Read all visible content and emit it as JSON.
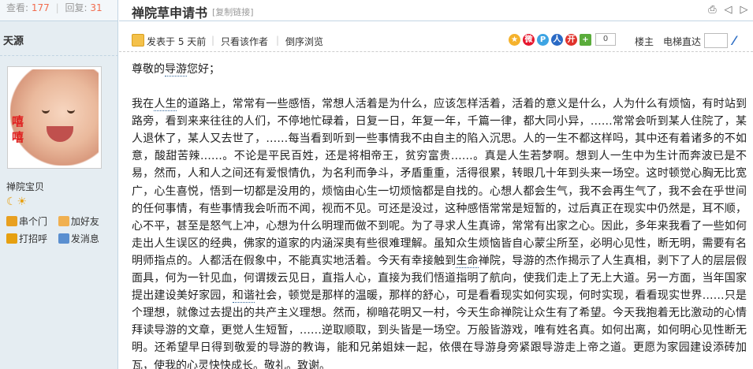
{
  "stats": {
    "views_label": "查看:",
    "views": "177",
    "replies_label": "回复:",
    "replies": "31"
  },
  "thread": {
    "title": "禅院草申请书",
    "copy_link": "[复制链接]"
  },
  "toolbar_icons": [
    "print-icon",
    "prev-thread-icon",
    "next-thread-icon"
  ],
  "author": {
    "name": "天源",
    "avatar_text": "嘻嘻",
    "group": "禅院宝贝",
    "stars": "☾☀"
  },
  "user_actions": [
    {
      "label": "串个门",
      "icon": "home-icon"
    },
    {
      "label": "加好友",
      "icon": "add-friend-icon"
    },
    {
      "label": "打招呼",
      "icon": "greet-icon"
    },
    {
      "label": "发消息",
      "icon": "message-icon"
    }
  ],
  "post_meta": {
    "posted": "发表于 5 天前",
    "only_author": "只看该作者",
    "reverse": "倒序浏览",
    "share_count": "0",
    "floor": "楼主",
    "jump_label": "电梯直达"
  },
  "share_icons": [
    {
      "name": "qzone-icon",
      "color": "#f5b22c",
      "glyph": "★"
    },
    {
      "name": "weibo-icon",
      "color": "#e6162d",
      "glyph": "微"
    },
    {
      "name": "tencent-weibo-icon",
      "color": "#3da4e3",
      "glyph": "P"
    },
    {
      "name": "renren-icon",
      "color": "#2a6ac5",
      "glyph": "人"
    },
    {
      "name": "kaixin-icon",
      "color": "#e0322b",
      "glyph": "开"
    },
    {
      "name": "more-share-icon",
      "color": "#5aac3b",
      "glyph": "+"
    }
  ],
  "content": {
    "greeting_pre": "尊敬的",
    "greeting_kw": "导游",
    "greeting_post": "您好；",
    "p1": "我在",
    "p1_kw": "人生",
    "p1_rest": "的道路上，常常有一些感悟，常想人活着是为什么，应该怎样活着，活着的意义是什么，人为什么有烦恼，有时站到路旁，看到来来往往的人们，不停地忙碌着，日复一日，年复一年，千篇一律，都大同小异，……常常会听到某人住院了，某人退休了，某人又去世了，……每当看到听到一些事情我不由自主的陷入沉思。人的一生不都这样吗，其中还有着诸多的不如意，酸甜苦辣……。不论是平民百姓，还是将相帝王，贫穷富贵……。真是人生若梦啊。想到人一生中为生计而奔波已是不易，然而，人和人之间还有爱恨情仇，为名利而争斗，矛盾重重，活得很累，转眼几十年到头来一场空。这时顿觉心胸无比宽广，心生喜悦，悟到一切都是没用的，烦恼由心生一切烦恼都是自找的。心想人都会生气，我不会再生气了，我不会在乎世间的任何事情，有些事情我会听而不闻，视而不见。可还是没过，这种感悟常常是短暂的，过后真正在现实中仍然是，耳不顺，心不平，甚至是怒气上冲，心想为什么明理而做不到呢。为了寻求人生真谛，常常有出家之心。因此，多年来我看了一些如何走出人生误区的经典，佛家的道家的内涵深奥有些很难理解。虽知众生烦恼皆自心蒙尘所至，必明心见性，断无明，需要有名明师指点的。人都活在假象中，不能真实地活着。今天有幸接触到",
    "p1_kw2": "生命",
    "p1_rest2": "禅院，导游的杰作揭示了人生真相，剥下了人的层层假面具，何为一针见血，何谓拨云见日，直指人心，直接为我们悟道指明了航向，使我们走上了无上大道。另一方面，当年国家提出建设美好家园，",
    "p1_kw3": "和谐",
    "p1_rest3": "社会，顿觉是那样的温暖，那样的舒心，可是看看现实如何实现，何时实现，看看现实世界……只是个理想，就像过去提出的共产主义理想。然而，柳暗花明又一村，今天生命禅院让众生有了希望。今天我抱着无比激动的心情拜读导游的文章，更觉人生短暂，……逆取顺取，到头皆是一场空。万般皆游戏，唯有姓名真。如何出离，如何明心见性断无明。还希望早日得到敬爱的导游的教诲，能和兄弟姐妹一起，依偎在导游身旁紧跟导游走上帝之道。更愿为家园建设添砖加瓦，使我的",
    "p1_kw4": "心灵",
    "p1_rest4": "快快成长。敬礼。致谢。"
  }
}
